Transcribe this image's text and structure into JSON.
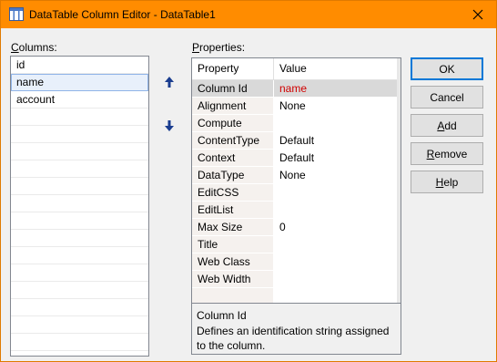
{
  "window": {
    "title": "DataTable Column Editor - DataTable1"
  },
  "columns_panel": {
    "label_mnemonic": "C",
    "label_rest": "olumns:",
    "items": [
      {
        "label": "id",
        "selected": false
      },
      {
        "label": "name",
        "selected": true
      },
      {
        "label": "account",
        "selected": false
      },
      {
        "label": "",
        "selected": false
      },
      {
        "label": "",
        "selected": false
      },
      {
        "label": "",
        "selected": false
      },
      {
        "label": "",
        "selected": false
      },
      {
        "label": "",
        "selected": false
      },
      {
        "label": "",
        "selected": false
      },
      {
        "label": "",
        "selected": false
      },
      {
        "label": "",
        "selected": false
      },
      {
        "label": "",
        "selected": false
      },
      {
        "label": "",
        "selected": false
      },
      {
        "label": "",
        "selected": false
      },
      {
        "label": "",
        "selected": false
      },
      {
        "label": "",
        "selected": false
      },
      {
        "label": "",
        "selected": false
      }
    ]
  },
  "properties_panel": {
    "label_mnemonic": "P",
    "label_rest": "roperties:",
    "header": {
      "property": "Property",
      "value": "Value"
    },
    "rows": [
      {
        "property": "Column Id",
        "value": "name",
        "selected": true
      },
      {
        "property": "Alignment",
        "value": "None"
      },
      {
        "property": "Compute",
        "value": ""
      },
      {
        "property": "ContentType",
        "value": "Default"
      },
      {
        "property": "Context",
        "value": "Default"
      },
      {
        "property": "DataType",
        "value": "None"
      },
      {
        "property": "EditCSS",
        "value": ""
      },
      {
        "property": "EditList",
        "value": ""
      },
      {
        "property": "Max Size",
        "value": "0"
      },
      {
        "property": "Title",
        "value": ""
      },
      {
        "property": "Web Class",
        "value": ""
      },
      {
        "property": "Web Width",
        "value": ""
      },
      {
        "property": "",
        "value": ""
      }
    ],
    "description": {
      "title": "Column Id",
      "text": "Defines an identification string assigned to the column."
    }
  },
  "buttons": {
    "ok": "OK",
    "cancel": "Cancel",
    "add_mnemonic": "A",
    "add_rest": "dd",
    "remove_mnemonic": "R",
    "remove_rest": "emove",
    "help_mnemonic": "H",
    "help_rest": "elp"
  },
  "colors": {
    "titlebar": "#ff8c00",
    "arrow": "#1a3d8f",
    "selected_value": "#d00000"
  },
  "icons": {
    "title": "datatable-icon",
    "close": "close-icon",
    "move_up": "arrow-up-icon",
    "move_down": "arrow-down-icon"
  }
}
